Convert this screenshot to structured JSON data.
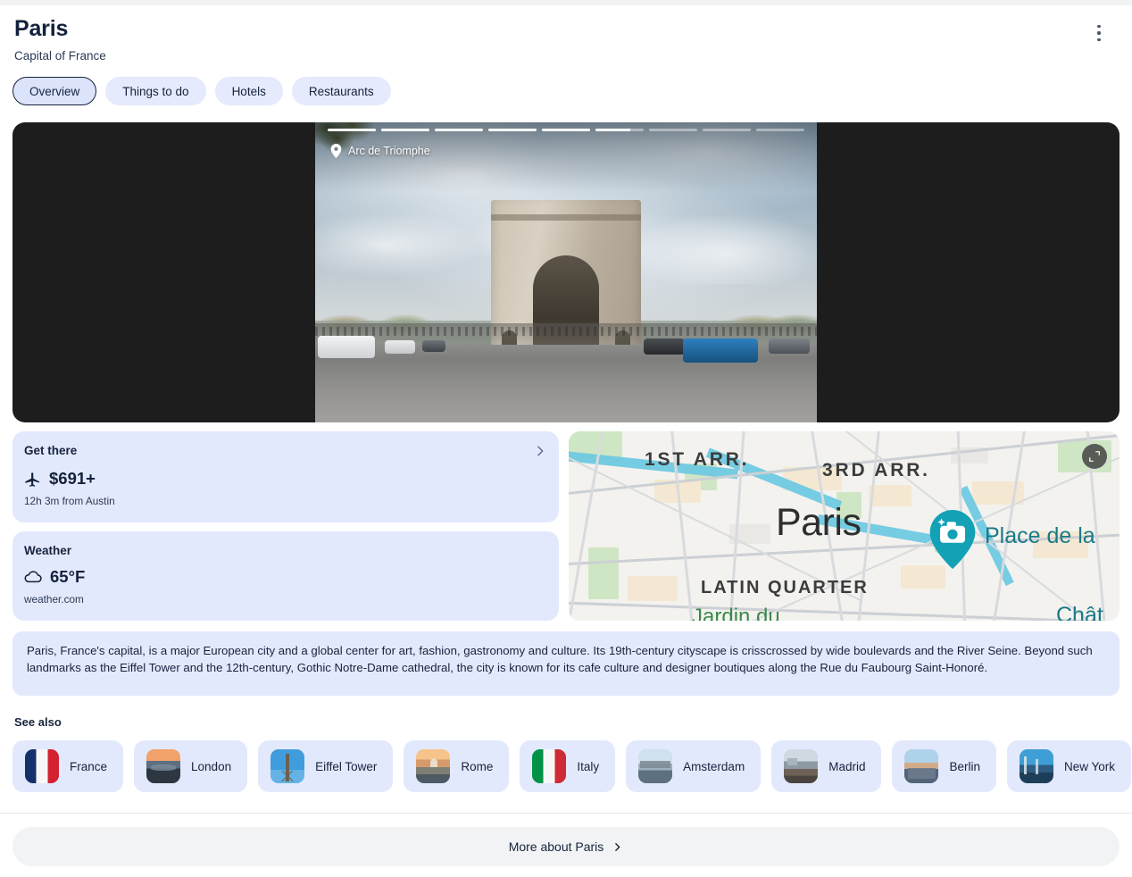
{
  "header": {
    "title": "Paris",
    "subtitle": "Capital of France",
    "overflow_menu_icon": "kebab-menu-icon"
  },
  "tabs": [
    {
      "label": "Overview",
      "active": true
    },
    {
      "label": "Things to do",
      "active": false
    },
    {
      "label": "Hotels",
      "active": false
    },
    {
      "label": "Restaurants",
      "active": false
    }
  ],
  "hero": {
    "place_label": "Arc de Triomphe",
    "pin_icon": "location-pin-icon",
    "story_segment_count": 9,
    "story_active_index": 5,
    "story_active_progress_pct": 72
  },
  "cards": {
    "get_there": {
      "title": "Get there",
      "icon": "airplane-icon",
      "price": "$691+",
      "detail": "12h 3m from Austin",
      "chevron_icon": "chevron-right-icon"
    },
    "weather": {
      "title": "Weather",
      "icon": "cloud-icon",
      "temperature": "65°F",
      "source": "weather.com"
    }
  },
  "map": {
    "expand_icon": "expand-map-icon",
    "pin_icon": "camera-map-pin-icon",
    "labels": {
      "arr_1": "1ST ARR.",
      "arr_3": "3RD ARR.",
      "city": "Paris",
      "poi": "Place de la",
      "quarter": "LATIN QUARTER",
      "park": "Jardin du",
      "poi2": "Chât"
    }
  },
  "description": "Paris, France's capital, is a major European city and a global center for art, fashion, gastronomy and culture. Its 19th-century cityscape is crisscrossed by wide boulevards and the River Seine. Beyond such landmarks as the Eiffel Tower and the 12th-century, Gothic Notre-Dame cathedral, the city is known for its cafe culture and designer boutiques along the Rue du Faubourg Saint-Honoré.",
  "see_also": {
    "label": "See also",
    "items": [
      {
        "label": "France",
        "thumb": "flag-fr"
      },
      {
        "label": "London",
        "thumb": "ph-london"
      },
      {
        "label": "Eiffel Tower",
        "thumb": "ph-eiffel"
      },
      {
        "label": "Rome",
        "thumb": "ph-rome"
      },
      {
        "label": "Italy",
        "thumb": "flag-it"
      },
      {
        "label": "Amsterdam",
        "thumb": "ph-ams"
      },
      {
        "label": "Madrid",
        "thumb": "ph-madrid"
      },
      {
        "label": "Berlin",
        "thumb": "ph-berlin"
      },
      {
        "label": "New York",
        "thumb": "ph-ny"
      }
    ]
  },
  "footer": {
    "more_label": "More about Paris",
    "chevron_icon": "chevron-right-icon"
  },
  "colors": {
    "card_bg": "#e3e9fd",
    "tab_bg": "#e5eafd",
    "tab_active_bg": "#dce4fb",
    "text_primary": "#16233d",
    "hero_bg": "#1d1d1d",
    "footer_bg": "#f1f3f4",
    "map_pin": "#12a1b5"
  }
}
